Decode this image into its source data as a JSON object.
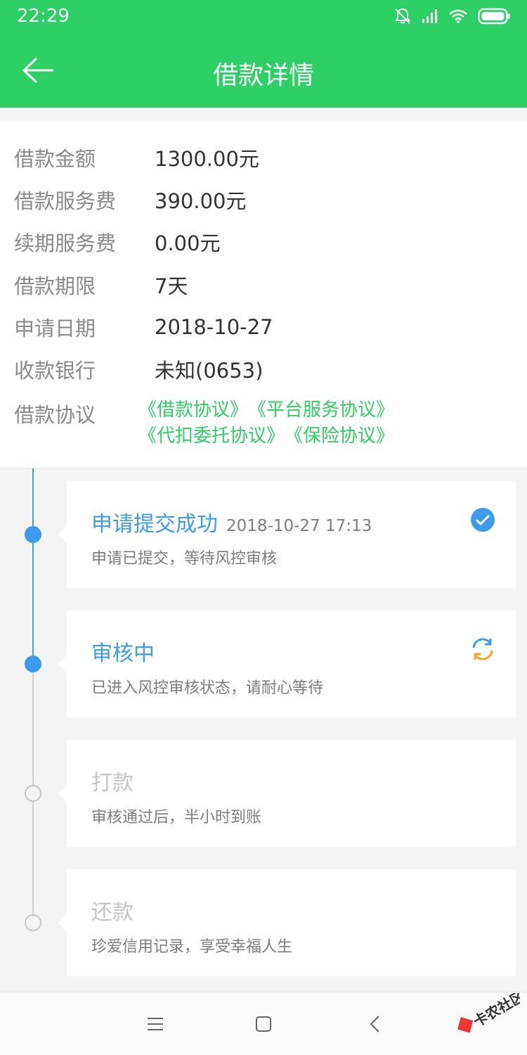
{
  "status_bar": {
    "time": "22:29"
  },
  "header": {
    "title": "借款详情"
  },
  "info": {
    "rows": [
      {
        "label": "借款金额",
        "value": "1300.00元"
      },
      {
        "label": "借款服务费",
        "value": "390.00元"
      },
      {
        "label": "续期服务费",
        "value": "0.00元"
      },
      {
        "label": "借款期限",
        "value": "7天"
      },
      {
        "label": "申请日期",
        "value": "2018-10-27"
      },
      {
        "label": "收款银行",
        "value": "未知(0653)"
      }
    ],
    "agreement_label": "借款协议",
    "agreements": [
      "《借款协议》",
      "《平台服务协议》",
      "《代扣委托协议》",
      "《保险协议》"
    ]
  },
  "timeline": {
    "steps": [
      {
        "title": "申请提交成功",
        "time": "2018-10-27 17:13",
        "desc": "申请已提交，等待风控审核",
        "state": "done",
        "icon": "check-circle-icon"
      },
      {
        "title": "审核中",
        "time": "",
        "desc": "已进入风控审核状态，请耐心等待",
        "state": "processing",
        "icon": "refresh-icon"
      },
      {
        "title": "打款",
        "time": "",
        "desc": "审核通过后，半小时到账",
        "state": "pending",
        "icon": ""
      },
      {
        "title": "还款",
        "time": "",
        "desc": "珍爱信用记录，享受幸福人生",
        "state": "pending",
        "icon": ""
      }
    ]
  },
  "colors": {
    "primary_green": "#2cd064",
    "active_blue": "#3d9bed",
    "processing_orange": "#f5a623",
    "inactive_gray": "#c4c4c4"
  }
}
